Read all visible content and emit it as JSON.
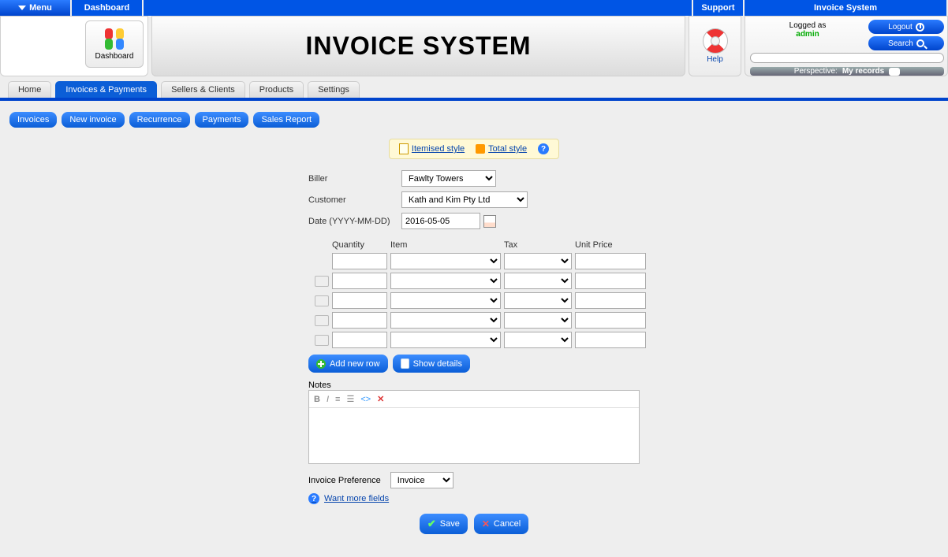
{
  "topbar": {
    "menu_label": "Menu",
    "dashboard_label": "Dashboard",
    "support_label": "Support",
    "system_name": "Invoice System"
  },
  "dashboard_tile": {
    "label": "Dashboard"
  },
  "header_title": "INVOICE SYSTEM",
  "help": {
    "label": "Help"
  },
  "user_panel": {
    "logged_as": "Logged as",
    "username": "admin",
    "logout": "Logout",
    "search": "Search",
    "search_placeholder": "",
    "perspective_prefix": "Perspective:",
    "perspective_value": "My records"
  },
  "main_tabs": {
    "home": "Home",
    "invoices_payments": "Invoices & Payments",
    "sellers_clients": "Sellers & Clients",
    "products": "Products",
    "settings": "Settings"
  },
  "sub_nav": {
    "invoices": "Invoices",
    "new_invoice": "New invoice",
    "recurrence": "Recurrence",
    "payments": "Payments",
    "sales_report": "Sales Report"
  },
  "style_toggle": {
    "itemised": "Itemised style",
    "total": "Total style"
  },
  "form": {
    "biller_label": "Biller",
    "biller_value": "Fawlty Towers",
    "customer_label": "Customer",
    "customer_value": "Kath and Kim Pty Ltd",
    "date_label": "Date (YYYY-MM-DD)",
    "date_value": "2016-05-05"
  },
  "items": {
    "head_quantity": "Quantity",
    "head_item": "Item",
    "head_tax": "Tax",
    "head_unitprice": "Unit Price",
    "row_count": 5
  },
  "actions": {
    "add_row": "Add new row",
    "show_details": "Show details"
  },
  "notes": {
    "label": "Notes"
  },
  "preference": {
    "label": "Invoice Preference",
    "value": "Invoice"
  },
  "want_more": "Want more fields",
  "final": {
    "save": "Save",
    "cancel": "Cancel"
  }
}
